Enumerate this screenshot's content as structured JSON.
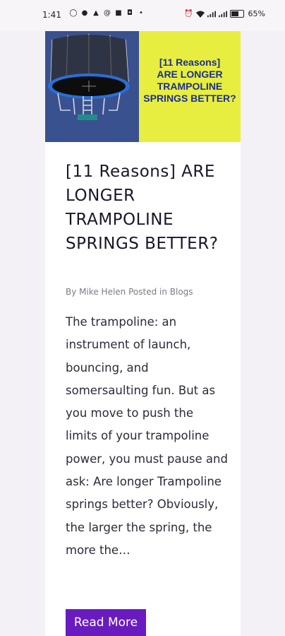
{
  "status_bar": {
    "time": "1:41",
    "battery": "65%",
    "battery_level": 0.65,
    "icons_left": [
      "whatsapp-icon",
      "messenger-icon",
      "snapchat-icon",
      "threads-icon",
      "facebook-icon",
      "instagram-icon",
      "dot-icon"
    ],
    "icons_right": [
      "alarm-icon",
      "wifi-icon",
      "signal-icon",
      "signal-icon",
      "battery-icon"
    ]
  },
  "hero": {
    "banner_text": [
      "[11 Reasons]",
      "ARE LONGER",
      "TRAMPOLINE",
      "SPRINGS BETTER?"
    ],
    "left_color": "#3a5190",
    "right_color": "#e7ee3f"
  },
  "post": {
    "title": "[11 Reasons] ARE LONGER TRAMPOLINE SPRINGS BETTER?",
    "meta": "By Mike Helen  Posted in Blogs",
    "excerpt": "The trampoline: an instrument of launch, bouncing, and somersaulting fun. But as you move to push the limits of your trampoline power, you must pause and ask: Are longer Trampoline springs better? Obviously, the larger the spring, the more the…",
    "read_more_label": "Read More",
    "button_color": "#6a1bbf"
  }
}
